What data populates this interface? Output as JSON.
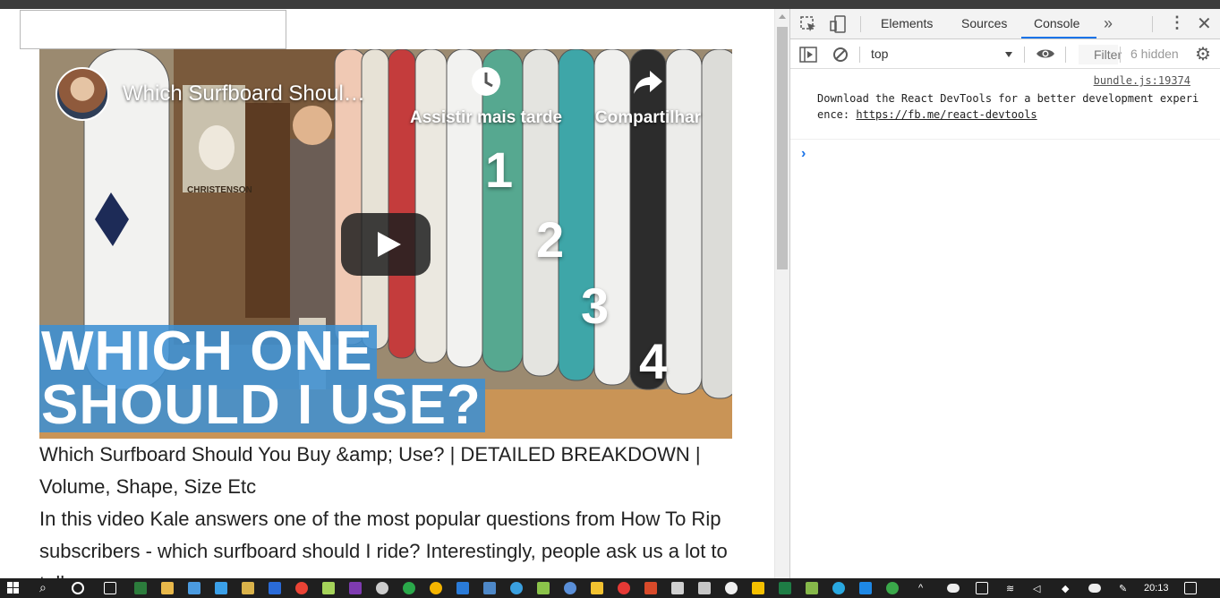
{
  "video": {
    "title": "Which Surfboard Shoul…",
    "watch_later": "Assistir mais tarde",
    "share": "Compartilhar",
    "thumb_numbers": [
      "1",
      "2",
      "3",
      "4"
    ],
    "thumb_headline_1": "WHICH ONE",
    "thumb_headline_2": "SHOULD I USE?",
    "sign_text": "CHRISTENSON"
  },
  "content": {
    "heading": "Which Surfboard Should You Buy &amp; Use? | DETAILED BREAKDOWN | Volume, Shape, Size Etc",
    "description": "In this video Kale answers one of the most popular questions from How To Rip subscribers - which surfboard should I ride? Interestingly, people ask us a lot to tell"
  },
  "devtools": {
    "tabs": [
      "Elements",
      "Sources",
      "Console"
    ],
    "active_tab": "Console",
    "context": "top",
    "filter_placeholder": "Filter",
    "hidden_count": "6 hidden",
    "message_source": "bundle.js:19374",
    "message_text": "Download the React DevTools for a better development experience: ",
    "message_link": "https://fb.me/react-devtools"
  },
  "taskbar": {
    "clock": "20:13"
  },
  "colors": {
    "accent": "#1a73e8",
    "banner": "#3e90d2"
  }
}
